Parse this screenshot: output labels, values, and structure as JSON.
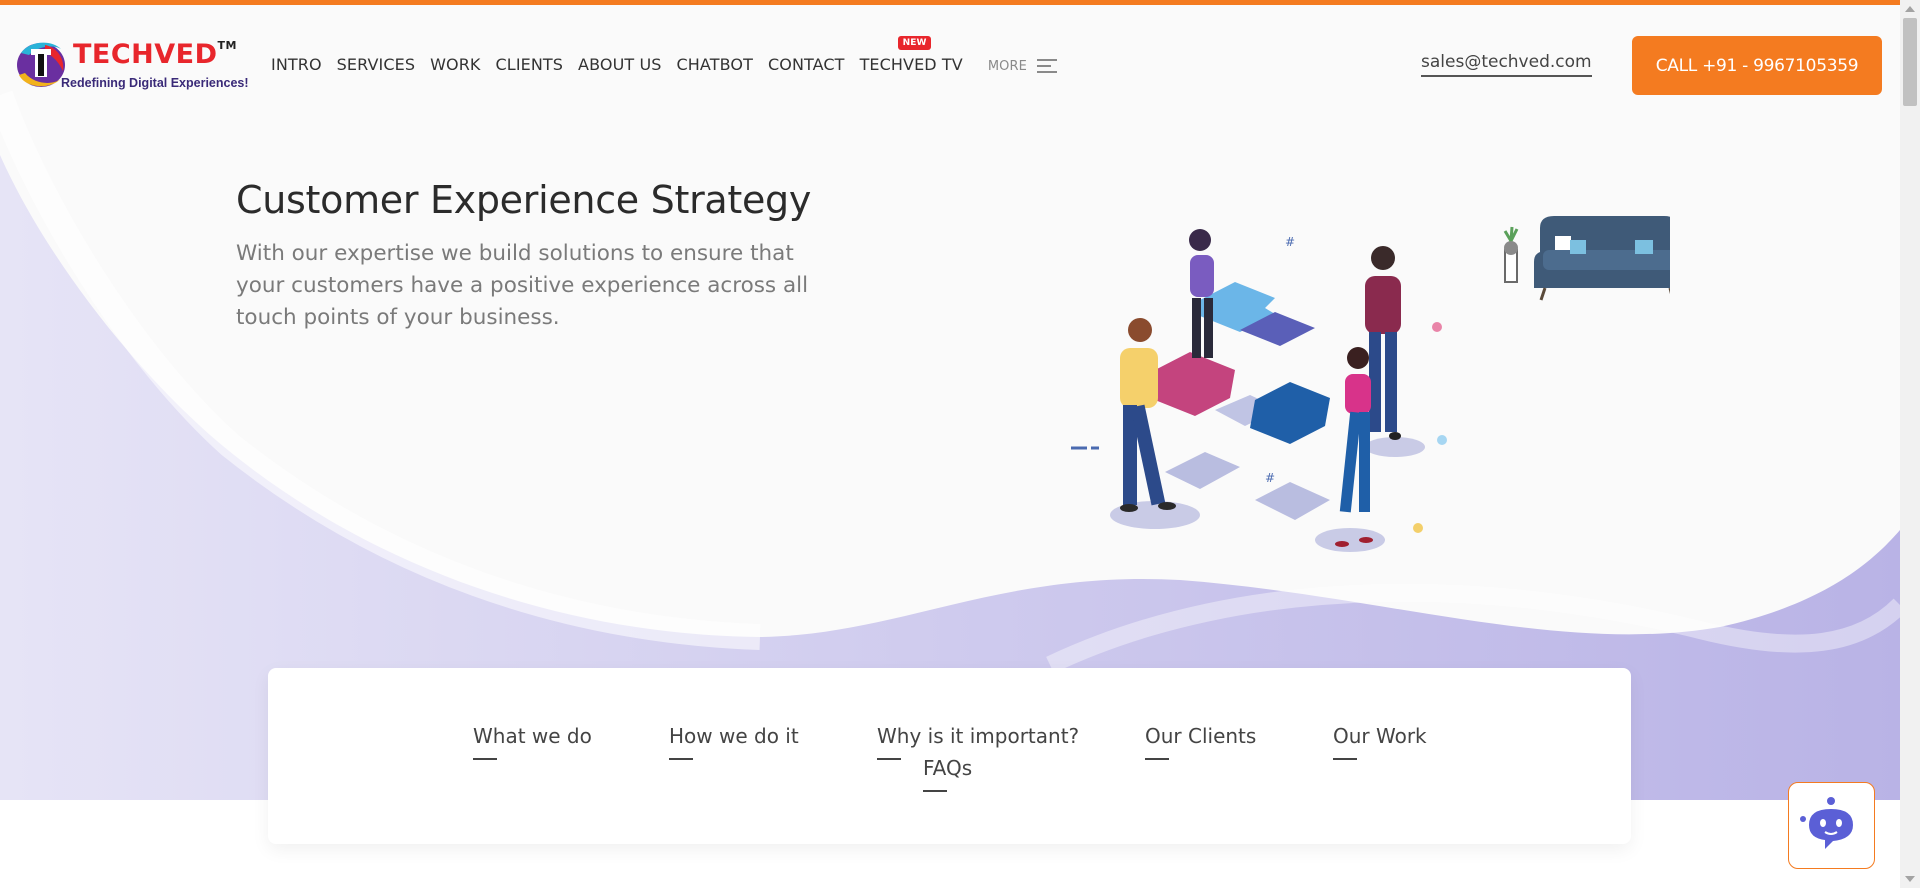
{
  "brand": {
    "name": "TECHVED",
    "tm": "TM",
    "tagline": "Redefining Digital Experiences!",
    "colors": {
      "accent": "#f47b20",
      "red": "#e8262c",
      "purple": "#3a2a78",
      "hero_wave": "#c8c4ec"
    }
  },
  "nav": {
    "items": [
      "INTRO",
      "SERVICES",
      "WORK",
      "CLIENTS",
      "ABOUT US",
      "CHATBOT",
      "CONTACT",
      "TECHVED TV"
    ],
    "tv_badge": "NEW",
    "more_label": "MORE",
    "more_icon": "hamburger-menu-icon"
  },
  "contact": {
    "email": "sales@techved.com",
    "call_label": "CALL +91 - 9967105359"
  },
  "hero": {
    "title": "Customer Experience Strategy",
    "subtitle": "With our expertise we build solutions to ensure that your customers have a positive experience across all touch points of your business.",
    "illustration": "team-puzzle-illustration"
  },
  "tabs": [
    "What we do",
    "How we do it",
    "Why is it important?",
    "Our Clients",
    "Our Work",
    "FAQs"
  ],
  "chat": {
    "icon": "chatbot-icon"
  }
}
